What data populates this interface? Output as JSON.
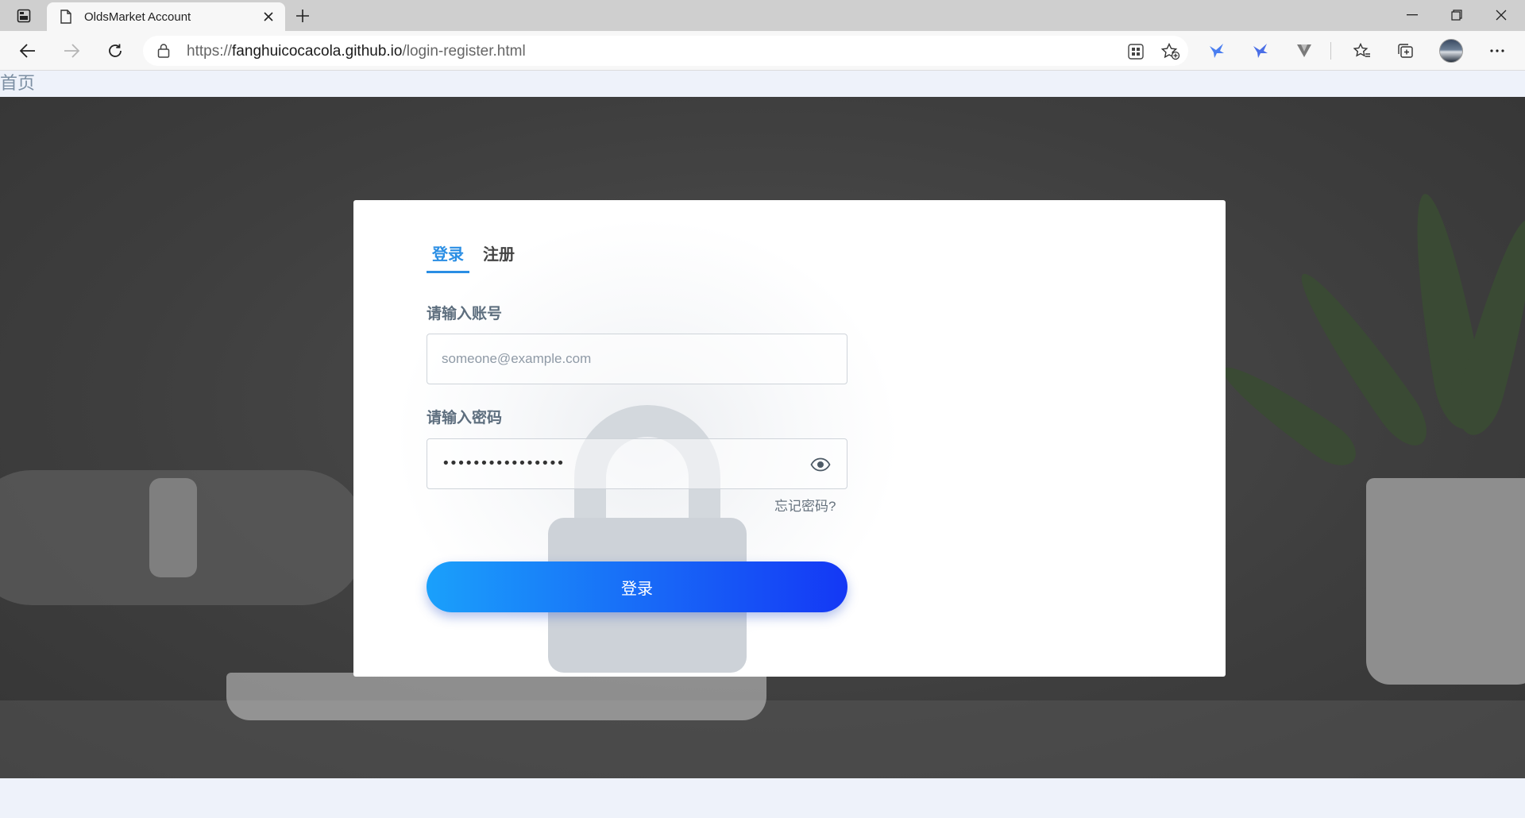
{
  "browser": {
    "tab_title": "OldsMarket Account",
    "url_domain": "fanghuicocacola.github.io",
    "url_prefix": "https://",
    "url_path": "/login-register.html"
  },
  "page": {
    "home_link": "首页"
  },
  "login": {
    "tabs": [
      "登录",
      "注册"
    ],
    "account_label": "请输入账号",
    "account_placeholder": "someone@example.com",
    "password_label": "请输入密码",
    "password_masked": "••••••••••••••••",
    "forgot_password": "忘记密码?",
    "submit_label": "登录"
  },
  "colors": {
    "accent": "#2a8ee4",
    "button_start": "#1aa0fb",
    "button_end": "#1438f5",
    "background": "#eef2fa"
  }
}
